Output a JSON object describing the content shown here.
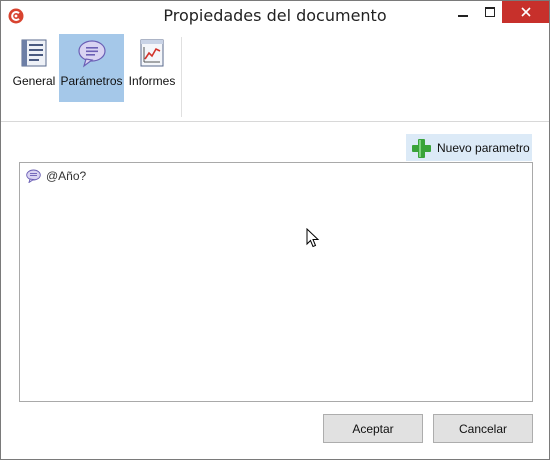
{
  "window": {
    "title": "Propiedades del documento",
    "controls": {
      "minimize": "minimize",
      "maximize": "maximize",
      "close": "close"
    }
  },
  "ribbon": {
    "tools": [
      {
        "label": "General",
        "icon": "document-list-icon",
        "selected": false
      },
      {
        "label": "Parámetros",
        "icon": "speech-bubble-icon",
        "selected": true
      },
      {
        "label": "Informes",
        "icon": "chart-report-icon",
        "selected": false
      }
    ]
  },
  "parameters": {
    "new_button_label": "Nuevo parametro",
    "items": [
      {
        "label": "@Año?",
        "icon": "speech-bubble-icon"
      }
    ]
  },
  "footer": {
    "accept_label": "Aceptar",
    "cancel_label": "Cancelar"
  },
  "colors": {
    "selected_tool_bg": "#a5c8e9",
    "close_button_bg": "#c7302b",
    "new_button_bg": "#dceaf7",
    "plus_green": "#3aa33a"
  }
}
